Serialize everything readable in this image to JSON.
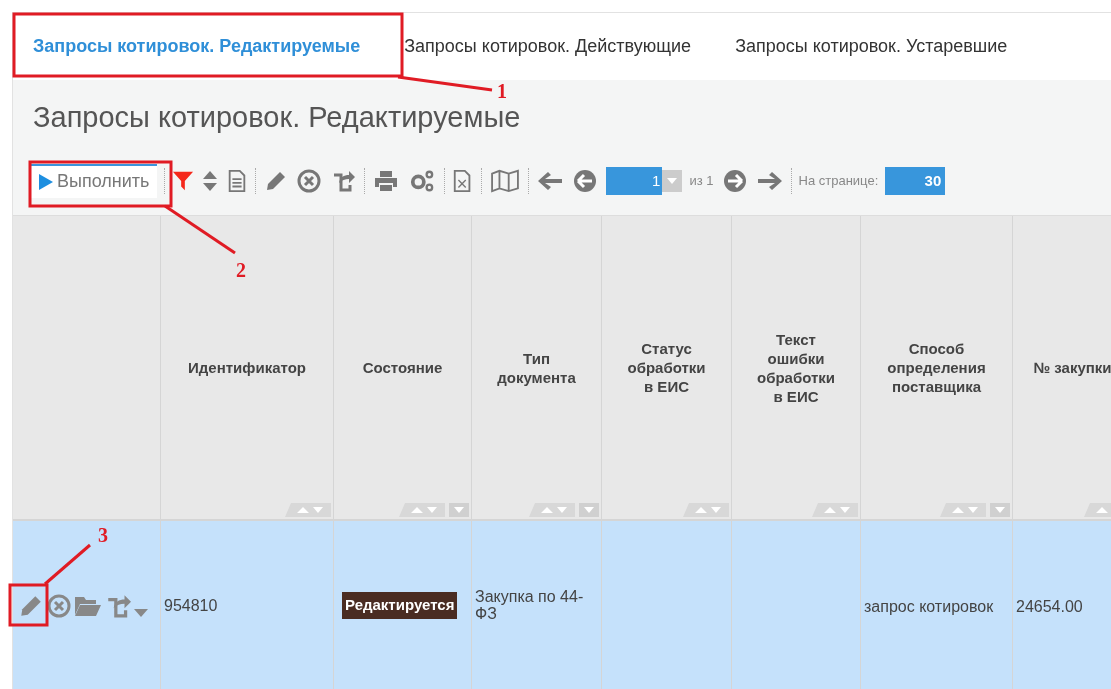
{
  "tabs": [
    {
      "label": "Запросы котировок. Редактируемые",
      "selected": true
    },
    {
      "label": "Запросы котировок. Действующие",
      "selected": false
    },
    {
      "label": "Запросы котировок. Устаревшие",
      "selected": false
    }
  ],
  "page_title": "Запросы котировок. Редактируемые",
  "toolbar": {
    "run_button": "Выполнить",
    "page": "1",
    "page_total": "из 1",
    "per_page_label": "На странице:",
    "per_page": "30"
  },
  "table": {
    "columns": [
      {
        "label": "Идентификатор",
        "filter": false
      },
      {
        "label": "Состояние",
        "filter": true
      },
      {
        "label": "Тип документа",
        "filter": true
      },
      {
        "label": "Статус обработки в ЕИС",
        "filter": false
      },
      {
        "label": "Текст ошибки обработки в ЕИС",
        "filter": false
      },
      {
        "label": "Способ определения поставщика",
        "filter": true
      },
      {
        "label": "№ закупки",
        "filter": false
      }
    ],
    "rows": [
      {
        "selected": true,
        "identifier": "954810",
        "state": "Редактируется",
        "doc_type": "Закупка по 44-ФЗ",
        "eis_status": "",
        "eis_error": "",
        "method": "запрос котировок",
        "purchase_no": "24654.00"
      }
    ]
  },
  "annotations": [
    {
      "number": "1"
    },
    {
      "number": "2"
    },
    {
      "number": "3"
    }
  ]
}
